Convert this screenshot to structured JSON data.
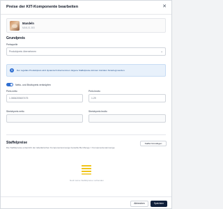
{
  "dialog": {
    "title": "Preise der KIT-Komponente bearbeiten",
    "close_icon": "close-icon"
  },
  "product": {
    "name": "Mandeln",
    "sku": "MAN-01-500"
  },
  "grundpreis": {
    "title": "Grundpreis",
    "preisquelle_label": "Preisquelle",
    "preisquelle_value": "Produktpreis übernehmen"
  },
  "info": {
    "icon": "info-icon",
    "text": "Der reguläre Produktpreis wird dynamisch übernommen. Eigene Staffelpreise können trotzdem hinterlegt werden."
  },
  "toggle": {
    "label": "Netto- und Bruttopreis verknüpfen",
    "on": true
  },
  "prices": {
    "netto_label": "Preis netto",
    "netto_value": "1.0654205607475",
    "brutto_label": "Preis brutto",
    "brutto_value": "1.29",
    "strich_netto_label": "Streichpreis netto",
    "strich_netto_value": "",
    "strich_brutto_label": "Streichpreis brutto",
    "strich_brutto_value": ""
  },
  "staffelpreise": {
    "title": "Staffelpreise",
    "description": "Die Staffelpreise entspricht der tabellarischen Komponentenmenge bestellte Bei Menge = Komponentenanmenge.",
    "add_button": "Staffel hinzufügen",
    "empty_icon": "list-icon",
    "empty_text": "Noch keine Staffelpreise vorhanden"
  },
  "footer": {
    "cancel": "Abbrechen",
    "save": "Speichern"
  },
  "colors": {
    "accent": "#2f6fd1",
    "primary_button": "#0f1f3a",
    "empty_icon": "#f0c419"
  }
}
